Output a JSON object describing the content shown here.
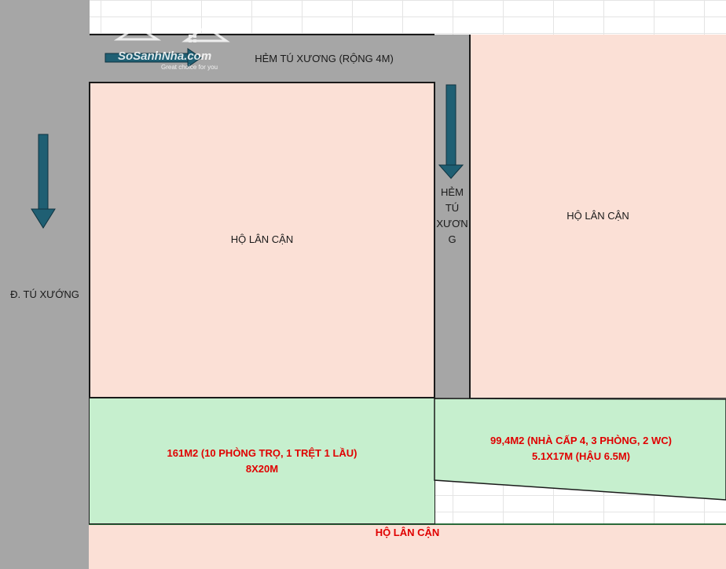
{
  "colors": {
    "road": "#a6a6a6",
    "neighbor": "#fbe0d6",
    "property": "#c6efce",
    "arrow": "#1f5f73",
    "highlight_text": "#e00000"
  },
  "streets": {
    "main_road": "Đ. TÚ XƯỚNG",
    "alley_top": "HẺM TÚ XƯƠNG (RỘNG 4M)",
    "alley_side_lines": [
      "HẺM",
      "TÚ",
      "XƯƠN",
      "G"
    ]
  },
  "parcels": {
    "neighbor_left": "HỘ LÂN CẬN",
    "neighbor_right": "HỘ LÂN CẬN",
    "neighbor_bottom": "HỘ LÂN CẬN",
    "lot_left": {
      "line1": "161M2 (10 PHÒNG TRỌ, 1 TRỆT 1 LẦU)",
      "line2": "8X20M"
    },
    "lot_right": {
      "line1": "99,4M2 (NHÀ CẤP 4, 3 PHÒNG, 2 WC)",
      "line2": "5.1X17M (HẬU 6.5M)"
    }
  },
  "watermark": {
    "brand": "SoSanhNha.com",
    "tagline": "Great choice for you"
  },
  "arrows": [
    {
      "name": "main-road-arrow",
      "direction": "down"
    },
    {
      "name": "side-alley-arrow",
      "direction": "down"
    },
    {
      "name": "top-alley-arrow",
      "direction": "right"
    }
  ]
}
